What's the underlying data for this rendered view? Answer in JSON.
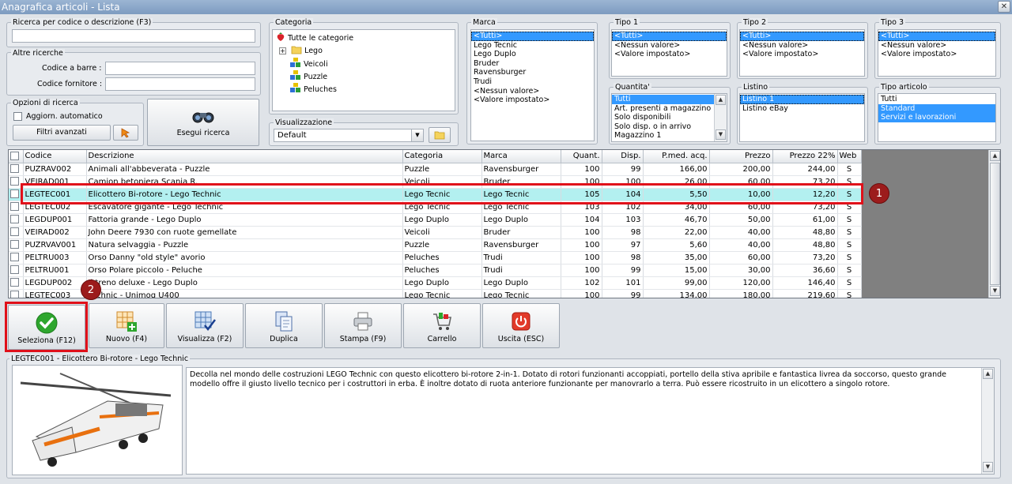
{
  "window": {
    "title": "Anagrafica articoli  - Lista",
    "close_glyph": "✕"
  },
  "search": {
    "group_label": "Ricerca per codice o descrizione (F3)",
    "value": ""
  },
  "other_search": {
    "group_label": "Altre ricerche",
    "barcode_label": "Codice a barre :",
    "supplier_code_label": "Codice fornitore :"
  },
  "options": {
    "group_label": "Opzioni di ricerca",
    "auto_update_label": "Aggiorn. automatico",
    "advanced_filters_label": "Filtri avanzati",
    "run_search_label": "Esegui ricerca"
  },
  "category": {
    "group_label": "Categoria",
    "root": "Tutte le categorie",
    "items": [
      "Lego",
      "Veicoli",
      "Puzzle",
      "Peluches"
    ],
    "expand_glyph": "+"
  },
  "view": {
    "group_label": "Visualizzazione",
    "selected": "Default",
    "dropdown_glyph": "▼"
  },
  "brand": {
    "group_label": "Marca",
    "items": [
      "<Tutti>",
      "Lego Tecnic",
      "Lego Duplo",
      "Bruder",
      "Ravensburger",
      "Trudi",
      "<Nessun valore>",
      "<Valore impostato>"
    ]
  },
  "type1": {
    "group_label": "Tipo 1",
    "items": [
      "<Tutti>",
      "<Nessun valore>",
      "<Valore impostato>"
    ]
  },
  "type2": {
    "group_label": "Tipo 2",
    "items": [
      "<Tutti>",
      "<Nessun valore>",
      "<Valore impostato>"
    ]
  },
  "type3": {
    "group_label": "Tipo 3",
    "items": [
      "<Tutti>",
      "<Nessun valore>",
      "<Valore impostato>"
    ]
  },
  "quantity": {
    "group_label": "Quantita'",
    "items": [
      "Tutti",
      "Art. presenti a magazzino",
      "Solo disponibili",
      "Solo disp. o in arrivo",
      "Magazzino 1"
    ]
  },
  "pricelist": {
    "group_label": "Listino",
    "items": [
      "Listino 1",
      "Listino eBay"
    ]
  },
  "article_type": {
    "group_label": "Tipo articolo",
    "items": [
      "Tutti",
      "Standard",
      "Servizi e lavorazioni"
    ]
  },
  "table": {
    "columns": [
      "Codice",
      "Descrizione",
      "Categoria",
      "Marca",
      "Quant.",
      "Disp.",
      "P.med. acq.",
      "Prezzo",
      "Prezzo 22%",
      "Web"
    ],
    "rows": [
      [
        "PUZRAV002",
        "Animali all'abbeverata - Puzzle",
        "Puzzle",
        "Ravensburger",
        "100",
        "99",
        "166,00",
        "200,00",
        "244,00",
        "S"
      ],
      [
        "VEIRAD001",
        "Camion betoniera Scania R.",
        "Veicoli",
        "Bruder",
        "100",
        "100",
        "26,00",
        "60,00",
        "73,20",
        "S"
      ],
      [
        "LEGTEC001",
        "Elicottero Bi-rotore - Lego Technic",
        "Lego Tecnic",
        "Lego Tecnic",
        "105",
        "104",
        "5,50",
        "10,00",
        "12,20",
        "S"
      ],
      [
        "LEGTEC002",
        "Escavatore gigante - Lego Technic",
        "Lego Tecnic",
        "Lego Tecnic",
        "103",
        "102",
        "34,00",
        "60,00",
        "73,20",
        "S"
      ],
      [
        "LEGDUP001",
        "Fattoria grande - Lego Duplo",
        "Lego Duplo",
        "Lego Duplo",
        "104",
        "103",
        "46,70",
        "50,00",
        "61,00",
        "S"
      ],
      [
        "VEIRAD002",
        "John Deere 7930 con ruote gemellate",
        "Veicoli",
        "Bruder",
        "100",
        "98",
        "22,00",
        "40,00",
        "48,80",
        "S"
      ],
      [
        "PUZRVAV001",
        "Natura selvaggia - Puzzle",
        "Puzzle",
        "Ravensburger",
        "100",
        "97",
        "5,60",
        "40,00",
        "48,80",
        "S"
      ],
      [
        "PELTRU003",
        "Orso Danny \"old style\" avorio",
        "Peluches",
        "Trudi",
        "100",
        "98",
        "35,00",
        "60,00",
        "73,20",
        "S"
      ],
      [
        "PELTRU001",
        "Orso Polare piccolo - Peluche",
        "Peluches",
        "Trudi",
        "100",
        "99",
        "15,00",
        "30,00",
        "36,60",
        "S"
      ],
      [
        "LEGDUP002",
        "Il treno deluxe - Lego Duplo",
        "Lego Duplo",
        "Lego Duplo",
        "102",
        "101",
        "99,00",
        "120,00",
        "146,40",
        "S"
      ],
      [
        "LEGTEC003",
        "Technic - Unimog U400",
        "Lego Tecnic",
        "Lego Tecnic",
        "100",
        "99",
        "134,00",
        "180,00",
        "219,60",
        "S"
      ]
    ]
  },
  "callouts": {
    "one": "1",
    "two": "2"
  },
  "toolbar": {
    "select": "Seleziona (F12)",
    "new": "Nuovo (F4)",
    "view": "Visualizza (F2)",
    "duplicate": "Duplica",
    "print": "Stampa (F9)",
    "cart": "Carrello",
    "exit": "Uscita (ESC)"
  },
  "detail": {
    "title": "LEGTEC001 - Elicottero Bi-rotore - Lego Technic",
    "description": "Decolla nel mondo delle costruzioni LEGO Technic con questo elicottero bi-rotore 2-in-1. Dotato di rotori funzionanti accoppiati, portello della stiva apribile e fantastica livrea da soccorso, questo grande modello offre il giusto livello tecnico per i costruttori in erba. È inoltre dotato di ruota anteriore funzionante per manovrarlo a terra. Può essere ricostruito in un elicottero a singolo rotore."
  },
  "scroll": {
    "up": "▲",
    "down": "▼"
  },
  "colors": {
    "selection": "#3399ff",
    "highlight_row": "#b3f0f0",
    "callout_box": "#e0101a",
    "badge": "#9c1c1c"
  }
}
